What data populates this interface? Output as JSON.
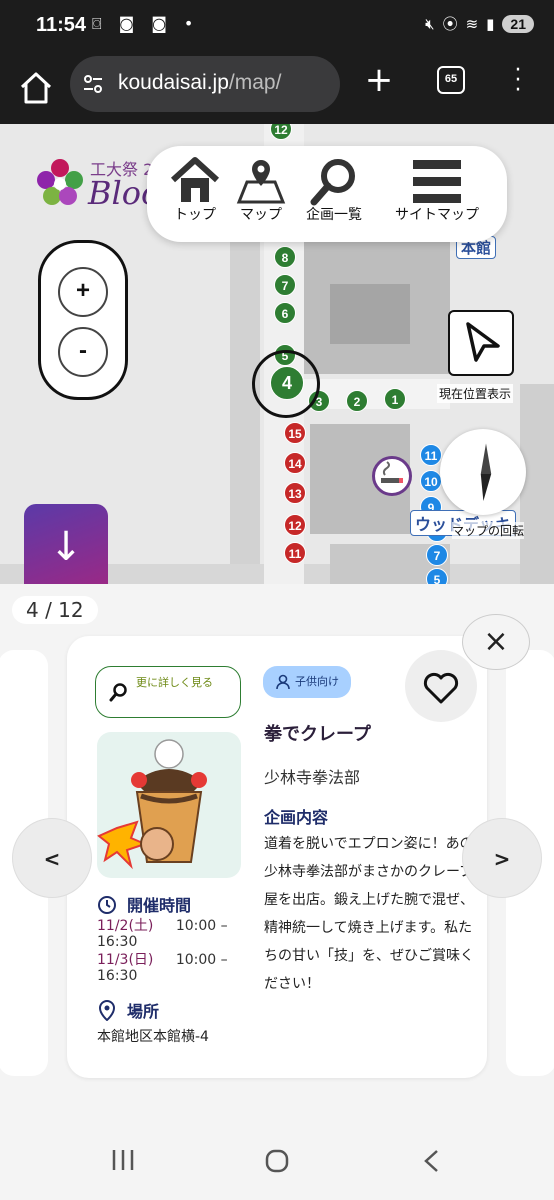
{
  "status_bar": {
    "time": "11:54",
    "battery": "21"
  },
  "browser": {
    "url_domain": "koudaisai.jp",
    "url_path": "/map/",
    "tab_count": "65"
  },
  "site": {
    "logo_small": "工大祭 2",
    "logo_text": "Bloo"
  },
  "top_nav": [
    {
      "label": "トップ",
      "icon": "house-icon"
    },
    {
      "label": "マップ",
      "icon": "map-pin-icon"
    },
    {
      "label": "企画一覧",
      "icon": "search-icon"
    },
    {
      "label": "サイトマップ",
      "icon": "hamburger-icon"
    }
  ],
  "map": {
    "zoom_in": "+",
    "zoom_out": "-",
    "locate_label": "現在位置表示",
    "rotate_label": "マップの回転",
    "label_honkan": "本館",
    "label_ud": "ウッドデッキ",
    "selected_marker": "4",
    "green_markers": [
      "12",
      "8",
      "7",
      "6",
      "5",
      "3",
      "2",
      "1"
    ],
    "red_markers": [
      "15",
      "14",
      "13",
      "12",
      "11"
    ],
    "blue_markers": [
      "11",
      "10",
      "9",
      "8",
      "7",
      "5"
    ],
    "colors": {
      "green": "#2e7d32",
      "red": "#c62828",
      "blue": "#1e88e5"
    }
  },
  "sheet": {
    "counter": "4 / 12",
    "close": "×",
    "prev": "<",
    "next": ">"
  },
  "card": {
    "details_button": "更に詳しく見る",
    "tag": "子供向け",
    "title": "拳でクレープ",
    "organizer": "少林寺拳法部",
    "description_heading": "企画内容",
    "description": "道着を脱いでエプロン姿に！あの少林寺拳法部がまさかのクレープ屋を出店。鍛え上げた腕で混ぜ、精神統一して焼き上げます。私たちの甘い「技」を、ぜひご賞味ください！",
    "schedule_heading": "開催時間",
    "schedule": [
      {
        "date": "11/2(土)",
        "time": "10:00 –",
        "end": "16:30"
      },
      {
        "date": "11/3(日)",
        "time": "10:00 –",
        "end": "16:30"
      }
    ],
    "place_heading": "場所",
    "place": "本館地区本館横-4"
  }
}
